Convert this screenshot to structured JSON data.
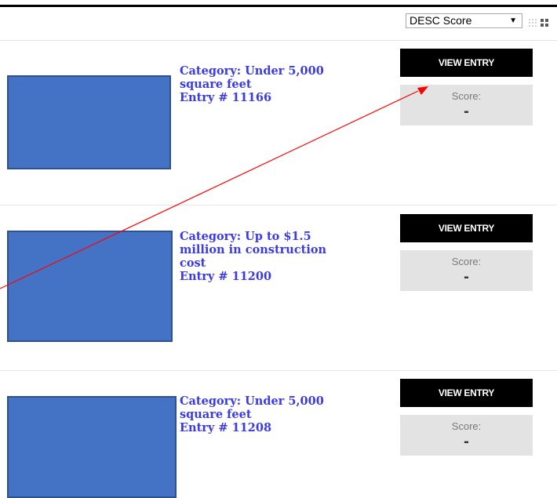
{
  "toolbar": {
    "sort_value": "DESC Score",
    "sort_caret": "▼",
    "view_icons": [
      "grid-small-icon",
      "grid-large-icon"
    ]
  },
  "entries": [
    {
      "category_lines": [
        "Category: Under 5,000",
        "square feet"
      ],
      "entry_label": "Entry # 11166",
      "button_label": "VIEW ENTRY",
      "score_label": "Score:",
      "score_value": "-"
    },
    {
      "category_lines": [
        "Category: Up to $1.5",
        "million in construction",
        "cost"
      ],
      "entry_label": "Entry # 11200",
      "button_label": "VIEW ENTRY",
      "score_label": "Score:",
      "score_value": "-"
    },
    {
      "category_lines": [
        "Category: Under 5,000",
        "square feet"
      ],
      "entry_label": "Entry # 11208",
      "button_label": "VIEW ENTRY",
      "score_label": "Score:",
      "score_value": "-"
    }
  ],
  "colors": {
    "thumbnail_fill": "#4472c4",
    "thumbnail_border": "#2f528f",
    "link_text": "#3a3ae6",
    "button_bg": "#000000",
    "score_bg": "#e3e3e3",
    "annotation_arrow": "#ff0000"
  }
}
